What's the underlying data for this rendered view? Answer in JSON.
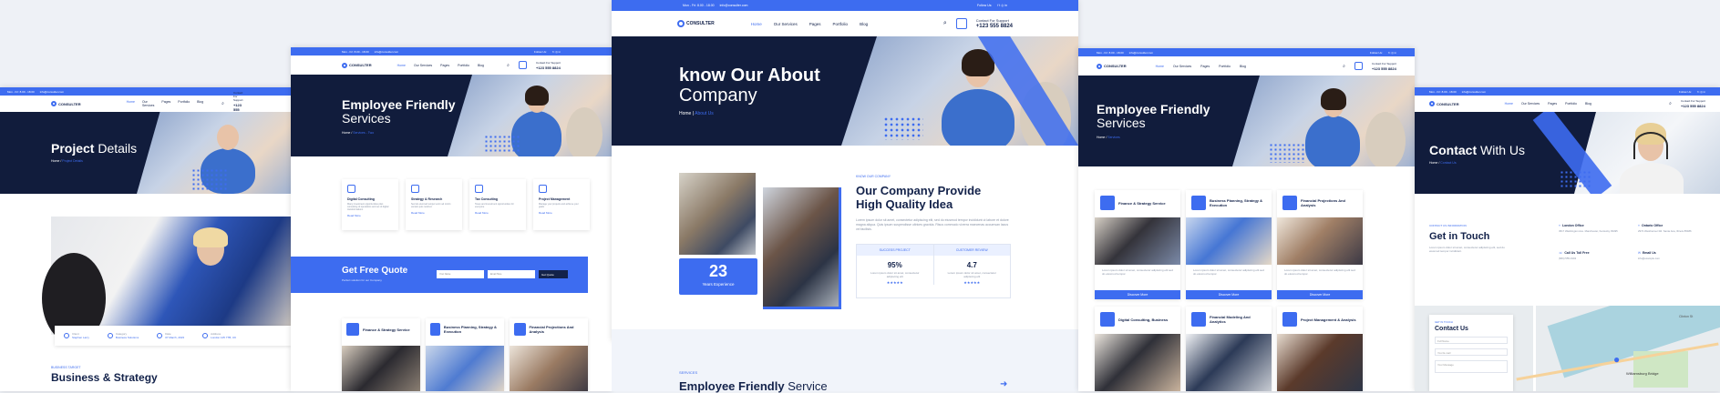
{
  "common": {
    "hours": "Mon - Fri: 8.00 - 18.00",
    "email": "info@consulter.com",
    "follow": "Follow Us:",
    "logo": "CONSULTER",
    "menu": [
      "Home",
      "Our Services",
      "Pages",
      "Portfolio",
      "Blog"
    ],
    "support_label": "Contact For Support",
    "support_phone": "+123 555 8824"
  },
  "panel1": {
    "title_bold": "Project",
    "title_light": "Details",
    "crumb_home": "Home",
    "crumb_current": "Project Details",
    "meta": [
      {
        "label": "Client",
        "value": "Stephen Larry"
      },
      {
        "label": "Category",
        "value": "Business Solutions"
      },
      {
        "label": "Date",
        "value": "07 March, 2023"
      },
      {
        "label": "Address",
        "value": "London 125 7TB, UK"
      }
    ],
    "eyebrow": "BUSINESS TARGET",
    "heading": "Business & Strategy"
  },
  "panel2": {
    "title_bold": "Employee Friendly",
    "title_light": "Services",
    "crumb_home": "Home",
    "crumb_current": "Services - Two",
    "services": [
      {
        "title": "Digital Consulting",
        "text": "Many investment opportunities plan consulting of operations and set of digital transformations",
        "link": "Read More"
      },
      {
        "title": "Strategy & Research",
        "text": "Sed do eiusmod tempor enim ad minim veniam quis nostrud.",
        "link": "Read More"
      },
      {
        "title": "Tax Consulting",
        "text": "Taxes and investment opportunities for everyone",
        "link": "Read More"
      },
      {
        "title": "Project Management",
        "text": "Manage your projects and achieve your goals",
        "link": "Read More"
      }
    ],
    "quote_title": "Get Free Quote",
    "quote_sub": "Perfect solution for our Company",
    "quote_name": "Your Name",
    "quote_email": "Email Here",
    "quote_btn": "Get Quote",
    "bottom_cards": [
      "Finance & Strategy Service",
      "Business Planning, Strategy & Execution",
      "Financial Projections And Analysis"
    ]
  },
  "panel3": {
    "title_bold": "know Our About",
    "title_light": "Company",
    "crumb_home": "Home",
    "crumb_current": "About Us",
    "exp_num": "23",
    "exp_label": "Years Experience",
    "eyebrow": "KNOW OUR COMPANY",
    "heading1": "Our Company Provide",
    "heading2": "High Quality Idea",
    "paragraph": "Lorem ipsum dolor sit amet, consectetur adipiscing elit, sed do eiusmod tempor incididunt ut labore et dolore magna aliqua. Quis ipsum suspendisse ultrices gravida. Risus commodo viverra maecenas accumsan lacus vel facilisis.",
    "tab1": "SUCCESS PROJECT",
    "tab2": "CUSTOMER REVIEW",
    "stat1": "95%",
    "stat2": "4.7",
    "stat_text": "Lorem ipsum dolor sit amet, consectetur adipiscing elit",
    "stars": "★★★★★",
    "services_eyebrow": "SERVICES",
    "services_bold": "Employee Friendly",
    "services_light": "Service"
  },
  "panel4": {
    "title_bold": "Employee Friendly",
    "title_light": "Services",
    "crumb_home": "Home",
    "crumb_current": "Services",
    "cards": [
      {
        "title": "Finance & Strategy Service",
        "text": "Lorem ipsum dolor sit amet, consectetur adipiscing elit sed do eiusmod tempor.",
        "btn": "Discover More"
      },
      {
        "title": "Business Planning, Strategy & Execution",
        "text": "Lorem ipsum dolor sit amet, consectetur adipiscing elit sed do eiusmod tempor.",
        "btn": "Discover More"
      },
      {
        "title": "Financial Projections And Analysis",
        "text": "Lorem ipsum dolor sit amet, consectetur adipiscing elit sed do eiusmod tempor.",
        "btn": "Discover More"
      },
      {
        "title": "Digital Consulting, Business",
        "text": "",
        "btn": ""
      },
      {
        "title": "Financial Modeling And Analytics",
        "text": "",
        "btn": ""
      },
      {
        "title": "Project Management & Analysis",
        "text": "",
        "btn": ""
      }
    ]
  },
  "panel5": {
    "title_bold": "Contact",
    "title_light": "With Us",
    "crumb_home": "Home",
    "crumb_current": "Contact Us",
    "eyebrow": "CONTACT US INFORMATION",
    "heading": "Get in Touch",
    "text": "Lorem ipsum dolor sit amet, consectetur adipiscing elit, sed do eiusmod tempor incididunt.",
    "london_label": "London Office",
    "london_addr": "4517 Washington Ave. Manchester, Kentucky 39495",
    "ontario_label": "Ontario Office",
    "ontario_addr": "2972 Westheimer Rd. Santa Ana, Illinois 85486",
    "call_label": "Call Us Toll Free",
    "call_val": "(684) 555-0102",
    "mail_label": "Email Us",
    "mail_val": "info@example.com",
    "form_eyebrow": "GET IN TOUCH",
    "form_heading": "Contact Us",
    "f_name": "Full Name",
    "f_mail": "Your E-mail",
    "f_msg": "Your Message",
    "map_label": "Williamsburg Bridge",
    "map_label2": "Clinton St"
  }
}
